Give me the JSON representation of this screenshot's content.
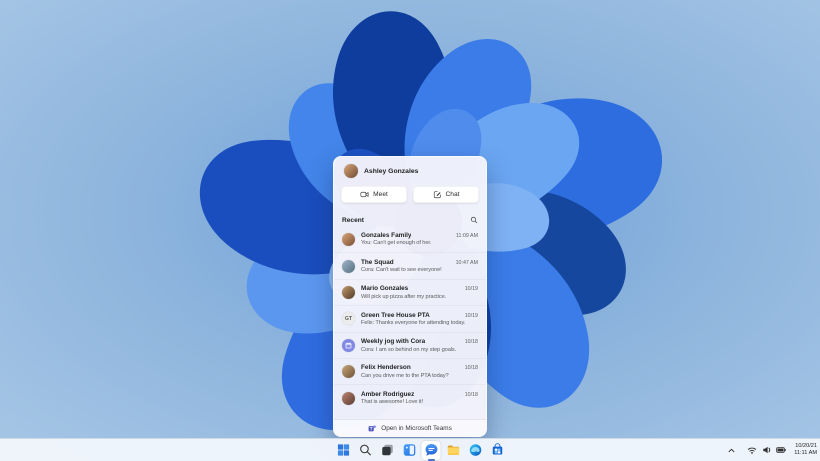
{
  "desktop": {
    "wallpaper_name": "windows-11-bloom",
    "sky_color": "#9cc0e2",
    "bloom_primary": "#2f6ce0"
  },
  "chat_flyout": {
    "user": {
      "name": "Ashley Gonzales"
    },
    "actions": {
      "meet_label": "Meet",
      "chat_label": "Chat"
    },
    "recent_label": "Recent",
    "conversations": [
      {
        "name": "Gonzales Family",
        "preview": "You: Can't get enough of her.",
        "time": "11:09 AM",
        "avatar": {
          "type": "photo",
          "icon": "family-photo-avatar",
          "colors": [
            "#d9a77a",
            "#7a4e33"
          ]
        }
      },
      {
        "name": "The Squad",
        "preview": "Cora: Can't wait to see everyone!",
        "time": "10:47 AM",
        "avatar": {
          "type": "photo",
          "icon": "group-photo-avatar",
          "colors": [
            "#9fb6c9",
            "#54707f"
          ]
        }
      },
      {
        "name": "Mario Gonzales",
        "preview": "Will pick up pizza after my practice.",
        "time": "10/19",
        "avatar": {
          "type": "photo",
          "icon": "person-photo-avatar",
          "colors": [
            "#c59a6b",
            "#4e3a28"
          ]
        }
      },
      {
        "name": "Green Tree House PTA",
        "preview": "Felix: Thanks everyone for attending today.",
        "time": "10/19",
        "avatar": {
          "type": "initials",
          "icon": "initials-avatar",
          "initials": "GT",
          "colors": [
            "#ececec",
            "#5f5f5f"
          ]
        }
      },
      {
        "name": "Weekly jog with Cora",
        "preview": "Cora: I am so behind on my step goals.",
        "time": "10/18",
        "avatar": {
          "type": "calendar",
          "icon": "calendar-avatar",
          "colors": [
            "#8289e4",
            "#ffffff"
          ]
        }
      },
      {
        "name": "Felix Henderson",
        "preview": "Can you drive me to the PTA today?",
        "time": "10/18",
        "avatar": {
          "type": "photo",
          "icon": "person-photo-avatar",
          "colors": [
            "#cba87c",
            "#6b5032"
          ]
        }
      },
      {
        "name": "Amber Rodriguez",
        "preview": "That is awesome! Love it!",
        "time": "10/18",
        "avatar": {
          "type": "photo",
          "icon": "person-photo-avatar",
          "colors": [
            "#bd8672",
            "#5a3a30"
          ]
        }
      }
    ],
    "footer_label": "Open in Microsoft Teams"
  },
  "taskbar": {
    "items": [
      {
        "id": "start",
        "icon": "windows-start-icon",
        "active": false
      },
      {
        "id": "search",
        "icon": "search-icon",
        "active": false
      },
      {
        "id": "task-view",
        "icon": "task-view-icon",
        "active": false
      },
      {
        "id": "widgets",
        "icon": "widgets-icon",
        "active": false
      },
      {
        "id": "chat",
        "icon": "teams-chat-icon",
        "active": true
      },
      {
        "id": "file-explorer",
        "icon": "file-explorer-icon",
        "active": false
      },
      {
        "id": "edge",
        "icon": "edge-browser-icon",
        "active": false
      },
      {
        "id": "store",
        "icon": "microsoft-store-icon",
        "active": false
      }
    ],
    "tray": {
      "icons": [
        "chevron-up-icon",
        "wifi-icon",
        "volume-icon",
        "battery-icon"
      ],
      "date": "10/20/21",
      "time": "11:11 AM"
    }
  }
}
